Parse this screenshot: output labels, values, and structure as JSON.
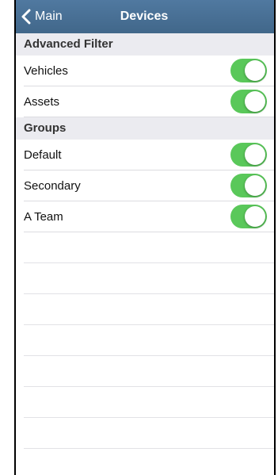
{
  "nav": {
    "back_label": "Main",
    "title": "Devices"
  },
  "colors": {
    "navbar": "#466e92",
    "toggle_on": "#5ac85a",
    "section_bg": "#ebebf0"
  },
  "sections": [
    {
      "header": "Advanced Filter",
      "items": [
        {
          "label": "Vehicles",
          "on": true
        },
        {
          "label": "Assets",
          "on": true
        }
      ]
    },
    {
      "header": "Groups",
      "items": [
        {
          "label": "Default",
          "on": true
        },
        {
          "label": "Secondary",
          "on": true
        },
        {
          "label": "A Team",
          "on": true
        }
      ]
    }
  ]
}
